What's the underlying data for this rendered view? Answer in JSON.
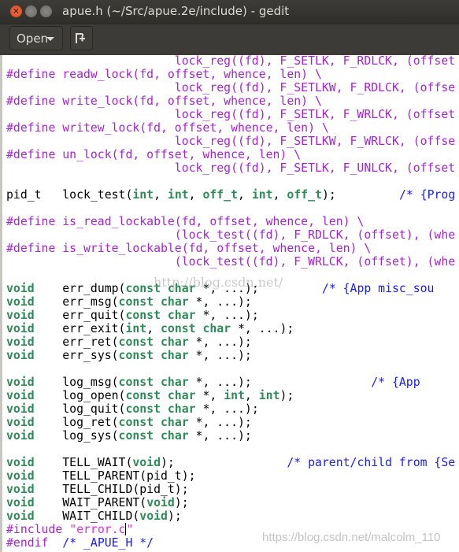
{
  "window": {
    "title": "apue.h (~/Src/apue.2e/include) - gedit",
    "close_glyph": "×",
    "min_glyph": "–",
    "max_glyph": "□"
  },
  "toolbar": {
    "open_label": "Open"
  },
  "editor": {
    "lines": [
      [
        [
          "p",
          "                        lock_reg((fd), F_SETLK, F_RDLCK, (offset"
        ]
      ],
      [
        [
          "p",
          "#define readw_lock(fd, offset, whence, len) \\"
        ]
      ],
      [
        [
          "p",
          "                        lock_reg((fd), F_SETLKW, F_RDLCK, (offse"
        ]
      ],
      [
        [
          "p",
          "#define write_lock(fd, offset, whence, len) \\"
        ]
      ],
      [
        [
          "p",
          "                        lock_reg((fd), F_SETLK, F_WRLCK, (offset"
        ]
      ],
      [
        [
          "p",
          "#define writew_lock(fd, offset, whence, len) \\"
        ]
      ],
      [
        [
          "p",
          "                        lock_reg((fd), F_SETLKW, F_WRLCK, (offse"
        ]
      ],
      [
        [
          "p",
          "#define un_lock(fd, offset, whence, len) \\"
        ]
      ],
      [
        [
          "p",
          "                        lock_reg((fd), F_SETLK, F_UNLCK, (offset"
        ]
      ],
      [],
      [
        [
          "n",
          "pid_t   lock_test("
        ],
        [
          "k",
          "int"
        ],
        [
          "n",
          ", "
        ],
        [
          "k",
          "int"
        ],
        [
          "n",
          ", "
        ],
        [
          "k",
          "off_t"
        ],
        [
          "n",
          ", "
        ],
        [
          "k",
          "int"
        ],
        [
          "n",
          ", "
        ],
        [
          "k",
          "off_t"
        ],
        [
          "n",
          ");         "
        ],
        [
          "c",
          "/* {Prog"
        ]
      ],
      [],
      [
        [
          "p",
          "#define is_read_lockable(fd, offset, whence, len) \\"
        ]
      ],
      [
        [
          "p",
          "                        (lock_test((fd), F_RDLCK, (offset), (whe"
        ]
      ],
      [
        [
          "p",
          "#define is_write_lockable(fd, offset, whence, len) \\"
        ]
      ],
      [
        [
          "p",
          "                        (lock_test((fd), F_WRLCK, (offset), (whe"
        ]
      ],
      [],
      [
        [
          "k",
          "void"
        ],
        [
          "n",
          "    err_dump("
        ],
        [
          "k",
          "const char"
        ],
        [
          "n",
          " *, ...);         "
        ],
        [
          "c",
          "/* {App misc_sou"
        ]
      ],
      [
        [
          "k",
          "void"
        ],
        [
          "n",
          "    err_msg("
        ],
        [
          "k",
          "const char"
        ],
        [
          "n",
          " *, ...);"
        ]
      ],
      [
        [
          "k",
          "void"
        ],
        [
          "n",
          "    err_quit("
        ],
        [
          "k",
          "const char"
        ],
        [
          "n",
          " *, ...);"
        ]
      ],
      [
        [
          "k",
          "void"
        ],
        [
          "n",
          "    err_exit("
        ],
        [
          "k",
          "int"
        ],
        [
          "n",
          ", "
        ],
        [
          "k",
          "const char"
        ],
        [
          "n",
          " *, ...);"
        ]
      ],
      [
        [
          "k",
          "void"
        ],
        [
          "n",
          "    err_ret("
        ],
        [
          "k",
          "const char"
        ],
        [
          "n",
          " *, ...);"
        ]
      ],
      [
        [
          "k",
          "void"
        ],
        [
          "n",
          "    err_sys("
        ],
        [
          "k",
          "const char"
        ],
        [
          "n",
          " *, ...);"
        ]
      ],
      [],
      [
        [
          "k",
          "void"
        ],
        [
          "n",
          "    log_msg("
        ],
        [
          "k",
          "const char"
        ],
        [
          "n",
          " *, ...);                 "
        ],
        [
          "c",
          "/* {App"
        ]
      ],
      [
        [
          "k",
          "void"
        ],
        [
          "n",
          "    log_open("
        ],
        [
          "k",
          "const char"
        ],
        [
          "n",
          " *, "
        ],
        [
          "k",
          "int"
        ],
        [
          "n",
          ", "
        ],
        [
          "k",
          "int"
        ],
        [
          "n",
          ");"
        ]
      ],
      [
        [
          "k",
          "void"
        ],
        [
          "n",
          "    log_quit("
        ],
        [
          "k",
          "const char"
        ],
        [
          "n",
          " *, ...);"
        ]
      ],
      [
        [
          "k",
          "void"
        ],
        [
          "n",
          "    log_ret("
        ],
        [
          "k",
          "const char"
        ],
        [
          "n",
          " *, ...);"
        ]
      ],
      [
        [
          "k",
          "void"
        ],
        [
          "n",
          "    log_sys("
        ],
        [
          "k",
          "const char"
        ],
        [
          "n",
          " *, ...);"
        ]
      ],
      [],
      [
        [
          "k",
          "void"
        ],
        [
          "n",
          "    TELL_WAIT("
        ],
        [
          "k",
          "void"
        ],
        [
          "n",
          ");                "
        ],
        [
          "c",
          "/* parent/child from {Se"
        ]
      ],
      [
        [
          "k",
          "void"
        ],
        [
          "n",
          "    TELL_PARENT(pid_t);"
        ]
      ],
      [
        [
          "k",
          "void"
        ],
        [
          "n",
          "    TELL_CHILD(pid_t);"
        ]
      ],
      [
        [
          "k",
          "void"
        ],
        [
          "n",
          "    WAIT_PARENT("
        ],
        [
          "k",
          "void"
        ],
        [
          "n",
          ");"
        ]
      ],
      [
        [
          "k",
          "void"
        ],
        [
          "n",
          "    WAIT_CHILD("
        ],
        [
          "k",
          "void"
        ],
        [
          "n",
          ");"
        ]
      ],
      [
        [
          "p",
          "#include "
        ],
        [
          "s",
          "\"error.c"
        ],
        [
          "cursor",
          ""
        ],
        [
          "s",
          "\""
        ]
      ],
      [
        [
          "p",
          "#endif  "
        ],
        [
          "c",
          "/* _APUE_H */"
        ]
      ]
    ]
  },
  "watermarks": {
    "center": "http://blog.csdn.net/",
    "corner": "https://blog.csdn.net/malcolm_110"
  },
  "colors": {
    "preprocessor": "#a523d6",
    "keyword": "#2e8b57",
    "comment": "#1a1aff",
    "string": "#e030e0",
    "titlebar": "#3c3b37",
    "close": "#e95420"
  }
}
